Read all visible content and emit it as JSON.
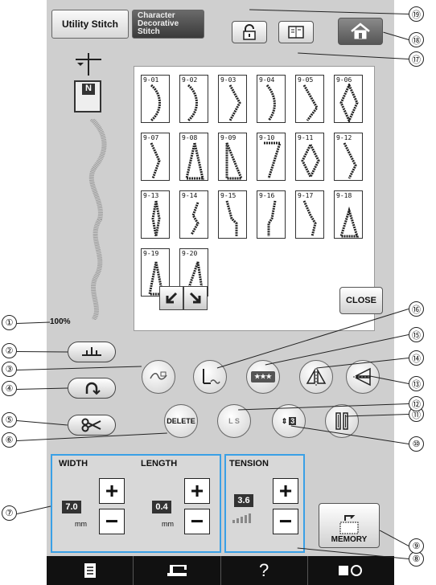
{
  "tabs": {
    "utility": "Utility Stitch",
    "character": "Character\nDecorative\nStitch"
  },
  "stitches": [
    "9-01",
    "9-02",
    "9-03",
    "9-04",
    "9-05",
    "9-06",
    "9-07",
    "9-08",
    "9-09",
    "9-10",
    "9-11",
    "9-12",
    "9-13",
    "9-14",
    "9-15",
    "9-16",
    "9-17",
    "9-18",
    "9-19",
    "9-20"
  ],
  "preview": {
    "presser_foot_letter": "N",
    "size_percent": "100%"
  },
  "buttons": {
    "close": "CLOSE",
    "delete": "DELETE",
    "ls": "L S",
    "density_icon": "3",
    "memory": "MEMORY"
  },
  "settings": {
    "width_label": "WIDTH",
    "width_value": "7.0",
    "width_unit": "mm",
    "length_label": "LENGTH",
    "length_value": "0.4",
    "length_unit": "mm",
    "tension_label": "TENSION",
    "tension_value": "3.6"
  },
  "bottom_help": "?",
  "callouts": [
    "①",
    "②",
    "③",
    "④",
    "⑤",
    "⑥",
    "⑦",
    "⑧",
    "⑨",
    "⑩",
    "⑪",
    "⑫",
    "⑬",
    "⑭",
    "⑮",
    "⑯",
    "⑰",
    "⑱",
    "⑲"
  ],
  "colors": {
    "group_border": "#3aa0e6",
    "panel": "#cfcfcf",
    "bottom_bar": "#111111"
  },
  "icons": [
    "lock-icon",
    "manual-icon",
    "home-icon",
    "needle-icon",
    "presser-foot-icon",
    "needle-position-icon",
    "thread-cutter-icon",
    "scissors-icon",
    "reverse-icon",
    "needle-mode-icon",
    "stitch-combination-icon",
    "vertical-mirror-icon",
    "horizontal-mirror-icon",
    "twin-needle-icon",
    "memory-icon",
    "doc-icon",
    "machine-icon",
    "camera-icon"
  ]
}
